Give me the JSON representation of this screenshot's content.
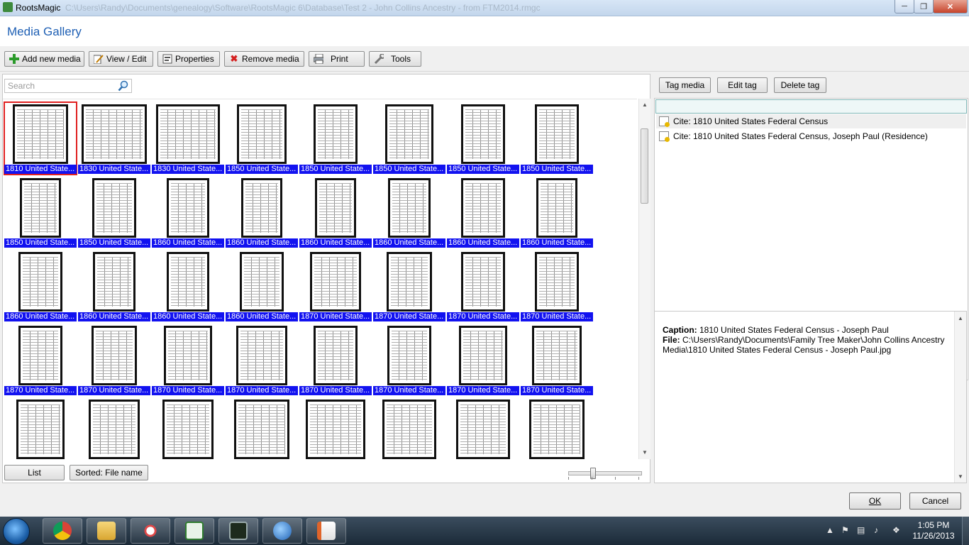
{
  "window": {
    "title": "RootsMagic",
    "path": "C:\\Users\\Randy\\Documents\\genealogy\\Software\\RootsMagic 6\\Database\\Test 2 - John Collins Ancestry - from FTM2014.rmgc",
    "min_icon": "minimize-icon",
    "max_icon": "maximize-icon",
    "close_icon": "close-icon"
  },
  "header": {
    "title": "Media Gallery"
  },
  "toolbar": {
    "add_label": "Add new media",
    "view_label": "View / Edit",
    "properties_label": "Properties",
    "remove_label": "Remove media",
    "print_label": "Print",
    "tools_label": "Tools"
  },
  "search": {
    "placeholder": "Search"
  },
  "gallery": {
    "rows": [
      [
        "1810 United State...",
        "1830 United State...",
        "1830 United State...",
        "1850 United State...",
        "1850 United State...",
        "1850 United State...",
        "1850 United State...",
        "1850 United State..."
      ],
      [
        "1850 United State...",
        "1850 United State...",
        "1860 United State...",
        "1860 United State...",
        "1860 United State...",
        "1860 United State...",
        "1860 United State...",
        "1860 United State..."
      ],
      [
        "1860 United State...",
        "1860 United State...",
        "1860 United State...",
        "1860 United State...",
        "1870 United State...",
        "1870 United State...",
        "1870 United State...",
        "1870 United State..."
      ],
      [
        "1870 United State...",
        "1870 United State...",
        "1870 United State...",
        "1870 United State...",
        "1870 United State...",
        "1870 United State...",
        "1870 United State...",
        "1870 United State..."
      ],
      [
        "",
        "",
        "",
        "",
        "",
        "",
        "",
        ""
      ]
    ],
    "selected_index": 0
  },
  "bottom": {
    "list_label": "List",
    "sort_label": "Sorted: File name"
  },
  "tags": {
    "tag_label": "Tag media",
    "edit_label": "Edit tag",
    "delete_label": "Delete tag",
    "items": [
      "Cite: 1810 United States Federal Census",
      "Cite: 1810 United States Federal Census, Joseph Paul (Residence)"
    ]
  },
  "details": {
    "caption_label": "Caption:",
    "caption_value": "1810 United States Federal Census - Joseph Paul",
    "file_label": "File:",
    "file_value": "C:\\Users\\Randy\\Documents\\Family Tree Maker\\John Collins Ancestry Media\\1810 United States Federal Census - Joseph Paul.jpg"
  },
  "footer": {
    "ok_label": "OK",
    "cancel_label": "Cancel"
  },
  "taskbar": {
    "time": "1:05 PM",
    "date": "11/26/2013",
    "apps": [
      "chrome-icon",
      "explorer-icon",
      "snipping-tool-icon",
      "rootsmagic-icon",
      "terminal-icon",
      "thunderbird-icon",
      "impress-icon"
    ]
  }
}
